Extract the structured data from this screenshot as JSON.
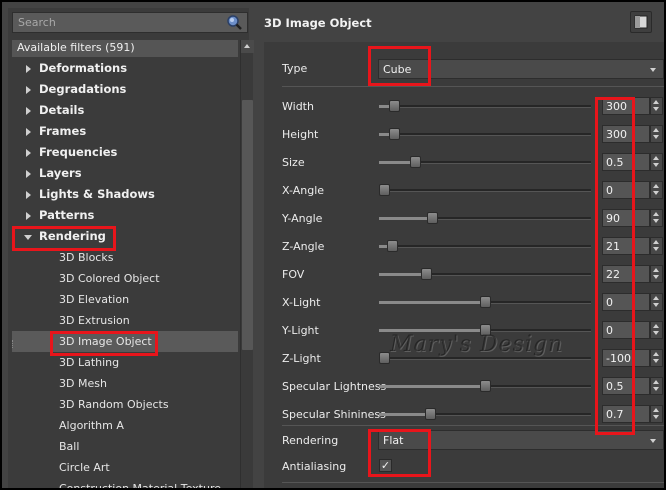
{
  "search": {
    "placeholder": "Search"
  },
  "filters": {
    "header": "Available filters (591)",
    "categories": [
      {
        "label": "Deformations",
        "expanded": false
      },
      {
        "label": "Degradations",
        "expanded": false
      },
      {
        "label": "Details",
        "expanded": false
      },
      {
        "label": "Frames",
        "expanded": false
      },
      {
        "label": "Frequencies",
        "expanded": false
      },
      {
        "label": "Layers",
        "expanded": false
      },
      {
        "label": "Lights & Shadows",
        "expanded": false
      },
      {
        "label": "Patterns",
        "expanded": false
      },
      {
        "label": "Rendering",
        "expanded": true
      }
    ],
    "rendering_items": [
      "3D Blocks",
      "3D Colored Object",
      "3D Elevation",
      "3D Extrusion",
      "3D Image Object",
      "3D Lathing",
      "3D Mesh",
      "3D Random Objects",
      "Algorithm A",
      "Ball",
      "Circle Art",
      "Construction Material Texture"
    ],
    "selected": "3D Image Object"
  },
  "panel": {
    "title": "3D Image Object",
    "type": {
      "label": "Type",
      "value": "Cube"
    },
    "params": [
      {
        "label": "Width",
        "value": "300",
        "level": 0.07
      },
      {
        "label": "Height",
        "value": "300",
        "level": 0.07
      },
      {
        "label": "Size",
        "value": "0.5",
        "level": 0.17
      },
      {
        "label": "X-Angle",
        "value": "0",
        "level": 0.0
      },
      {
        "label": "Y-Angle",
        "value": "90",
        "level": 0.25
      },
      {
        "label": "Z-Angle",
        "value": "21",
        "level": 0.06
      },
      {
        "label": "FOV",
        "value": "22",
        "level": 0.22
      },
      {
        "label": "X-Light",
        "value": "0",
        "level": 0.5
      },
      {
        "label": "Y-Light",
        "value": "0",
        "level": 0.5
      },
      {
        "label": "Z-Light",
        "value": "-100",
        "level": 0.0
      },
      {
        "label": "Specular Lightness",
        "value": "0.5",
        "level": 0.5
      },
      {
        "label": "Specular Shininess",
        "value": "0.7",
        "level": 0.24
      }
    ],
    "rendering": {
      "label": "Rendering",
      "value": "Flat"
    },
    "antialiasing": {
      "label": "Antialiasing",
      "checked": true
    }
  },
  "watermark": "Mary's Design",
  "colors": {
    "highlight": "#e8151b",
    "panel_bg": "#3b3b3b",
    "selected_bg": "#5a5a5a"
  }
}
